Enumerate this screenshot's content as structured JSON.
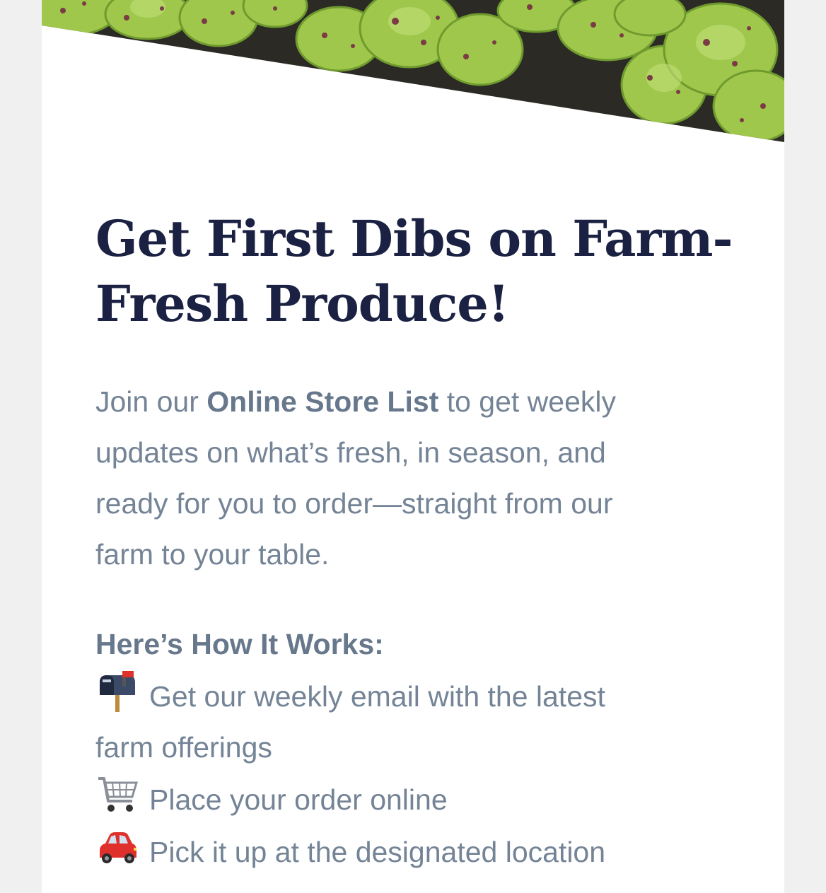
{
  "hero": {
    "image_description": "leafy-greens-photo",
    "colors": {
      "leaf": "#a9cf55",
      "leaf_dark": "#6f9a2e",
      "speckle": "#7a3b45",
      "soil": "#2b2a25"
    }
  },
  "headline": {
    "line1": "Get First Dibs on Farm-",
    "line2": "Fresh Produce!"
  },
  "intro": {
    "prefix": "Join our ",
    "bold": "Online Store List",
    "line1_suffix": " to get weekly",
    "line2": "updates on what’s fresh, in season, and",
    "line3": "ready for you to order—straight from our",
    "line4": "farm to your table."
  },
  "how_it_works": {
    "title": "Here’s How It Works:",
    "steps": [
      {
        "icon": "mailbox-icon",
        "line1": "Get our weekly email with the latest",
        "line2": "farm offerings"
      },
      {
        "icon": "shopping-cart-icon",
        "line1": "Place your order online"
      },
      {
        "icon": "car-icon",
        "line1": "Pick it up at the designated location"
      }
    ]
  },
  "colors": {
    "page_bg": "#f0f0f0",
    "card_bg": "#ffffff",
    "headline": "#1b2142",
    "body_text": "#748496"
  }
}
